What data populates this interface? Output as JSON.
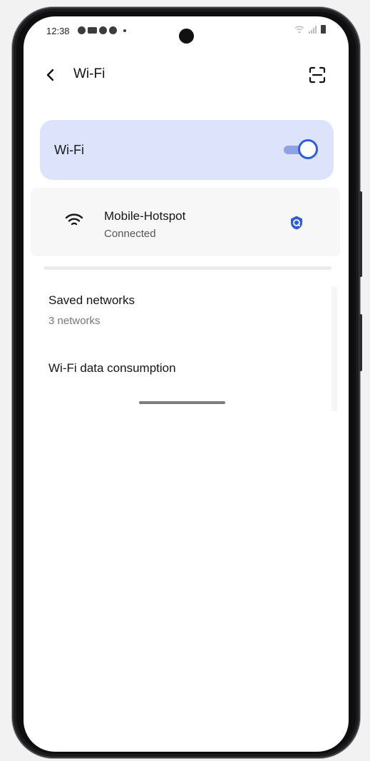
{
  "status_bar": {
    "time": "12:38"
  },
  "header": {
    "title": "Wi-Fi"
  },
  "wifi_toggle": {
    "label": "Wi-Fi",
    "enabled": true
  },
  "connected_network": {
    "name": "Mobile-Hotspot",
    "status": "Connected"
  },
  "list": {
    "saved_networks": {
      "title": "Saved networks",
      "subtitle": "3 networks"
    },
    "data_consumption": {
      "title": "Wi-Fi data consumption"
    }
  },
  "colors": {
    "accent": "#2f5be0",
    "card": "#dde3fa",
    "toggle_track": "#8ea3e6"
  },
  "icons": [
    "back-icon",
    "qr-scan-icon",
    "wifi-signal-icon",
    "shield-icon"
  ]
}
